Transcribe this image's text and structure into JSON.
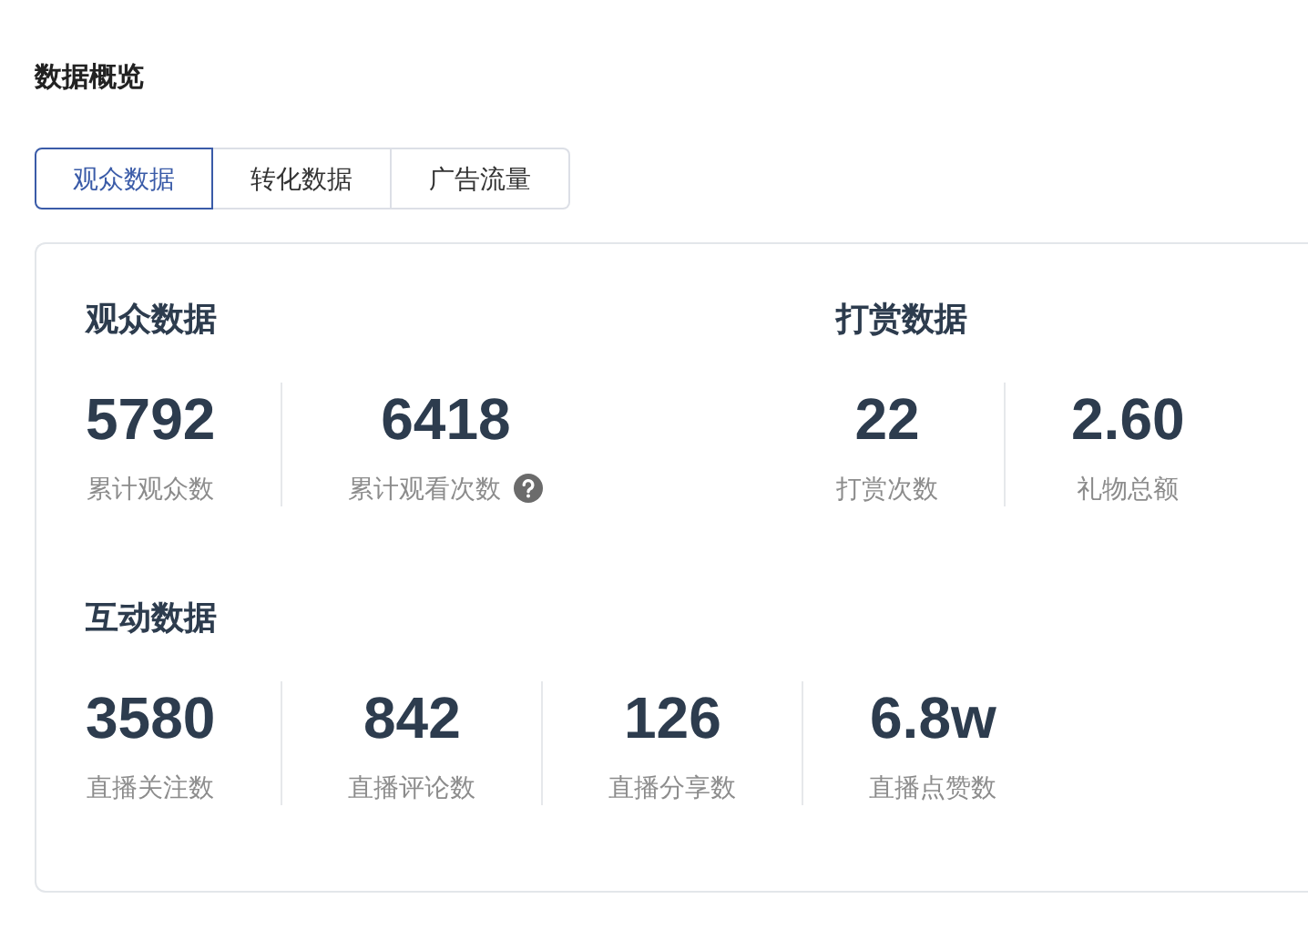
{
  "title": "数据概览",
  "tabs": [
    {
      "label": "观众数据",
      "selected": true
    },
    {
      "label": "转化数据",
      "selected": false
    },
    {
      "label": "广告流量",
      "selected": false
    }
  ],
  "rows": [
    [
      {
        "title": "观众数据",
        "stats": [
          {
            "value": "5792",
            "label": "累计观众数",
            "help": false
          },
          {
            "value": "6418",
            "label": "累计观看次数",
            "help": true
          }
        ]
      },
      {
        "title": "打赏数据",
        "stats": [
          {
            "value": "22",
            "label": "打赏次数",
            "help": false
          },
          {
            "value": "2.60",
            "label": "礼物总额",
            "help": false
          }
        ]
      }
    ],
    [
      {
        "title": "互动数据",
        "stats": [
          {
            "value": "3580",
            "label": "直播关注数",
            "help": false
          },
          {
            "value": "842",
            "label": "直播评论数",
            "help": false
          },
          {
            "value": "126",
            "label": "直播分享数",
            "help": false
          },
          {
            "value": "6.8w",
            "label": "直播点赞数",
            "help": false
          }
        ]
      }
    ]
  ]
}
